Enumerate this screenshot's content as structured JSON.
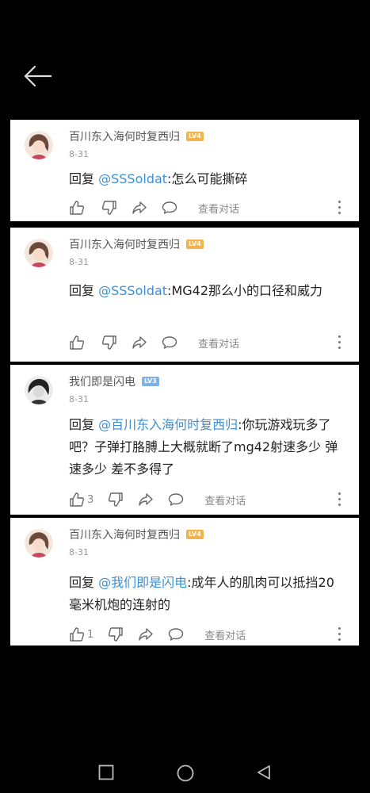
{
  "colors": {
    "mention": "#3e8fcf",
    "level_badge": "#f0b44a",
    "level_badge_alt": "#7fb0e6"
  },
  "comments": [
    {
      "user": "百川东入海何时复西归",
      "level": "LV4",
      "date": "8-31",
      "reply_prefix": "回复",
      "mention": "@SSSoldat",
      "body": ":怎么可能撕碎",
      "likes": "",
      "view_label": "查看对话"
    },
    {
      "user": "百川东入海何时复西归",
      "level": "LV4",
      "date": "8-31",
      "reply_prefix": "回复",
      "mention": "@SSSoldat",
      "body": ":MG42那么小的口径和威力",
      "likes": "",
      "view_label": "查看对话"
    },
    {
      "user": "我们即是闪电",
      "level": "LV3",
      "date": "8-31",
      "reply_prefix": "回复",
      "mention": "@百川东入海何时复西归",
      "body": ":你玩游戏玩多了吧？子弹打胳膊上大概就断了mg42射速多少 弹速多少 差不多得了",
      "likes": "3",
      "view_label": "查看对话"
    },
    {
      "user": "百川东入海何时复西归",
      "level": "LV4",
      "date": "8-31",
      "reply_prefix": "回复",
      "mention": "@我们即是闪电",
      "body": ":成年人的肌肉可以抵挡20毫米机炮的连射的",
      "likes": "1",
      "view_label": "查看对话"
    }
  ]
}
